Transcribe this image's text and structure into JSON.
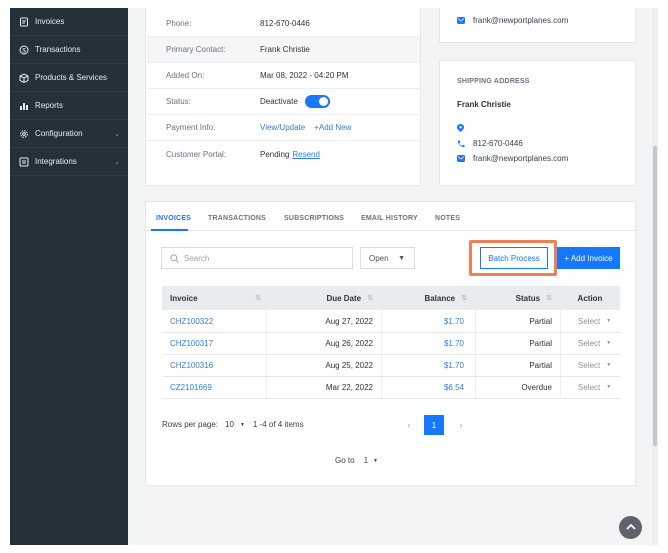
{
  "sidebar": {
    "items": [
      {
        "label": "Invoices",
        "icon": "invoice-icon",
        "chevron": false
      },
      {
        "label": "Transactions",
        "icon": "dollar-circle-icon",
        "chevron": false
      },
      {
        "label": "Products & Services",
        "icon": "box-icon",
        "chevron": false
      },
      {
        "label": "Reports",
        "icon": "bar-chart-icon",
        "chevron": false
      },
      {
        "label": "Configuration",
        "icon": "gear-icon",
        "chevron": true
      },
      {
        "label": "Integrations",
        "icon": "integrations-icon",
        "chevron": true
      }
    ]
  },
  "details": {
    "phone": {
      "label": "Phone:",
      "value": "812-670-0446"
    },
    "primary_contact": {
      "label": "Primary Contact:",
      "value": "Frank Christie"
    },
    "added_on": {
      "label": "Added On:",
      "value": "Mar 08, 2022 - 04:20 PM"
    },
    "status": {
      "label": "Status:",
      "value": "Deactivate",
      "toggle_on": true
    },
    "payment_info": {
      "label": "Payment Info:",
      "link1": "View/Update",
      "link2": "+Add New"
    },
    "customer_portal": {
      "label": "Customer Portal:",
      "value": "Pending",
      "link": "Resend"
    }
  },
  "top_contact": {
    "email": "frank@newportplanes.com"
  },
  "shipping": {
    "title": "SHIPPING ADDRESS",
    "name": "Frank Christie",
    "phone": "812-670-0446",
    "email": "frank@newportplanes.com"
  },
  "tabs": [
    "INVOICES",
    "TRANSACTIONS",
    "SUBSCRIPTIONS",
    "EMAIL HISTORY",
    "NOTES"
  ],
  "toolbar": {
    "search_placeholder": "Search",
    "filter_value": "Open",
    "batch_label": "Batch Process",
    "add_label": "+ Add Invoice"
  },
  "table": {
    "headers": {
      "invoice": "Invoice",
      "due": "Due Date",
      "balance": "Balance",
      "status": "Status",
      "action": "Action"
    },
    "rows": [
      {
        "invoice": "CHZ100322",
        "due": "Aug 27, 2022",
        "balance": "$1.70",
        "status": "Partial",
        "action": "Select"
      },
      {
        "invoice": "CHZ100317",
        "due": "Aug 26, 2022",
        "balance": "$1.70",
        "status": "Partial",
        "action": "Select"
      },
      {
        "invoice": "CHZ100316",
        "due": "Aug 25, 2022",
        "balance": "$1.70",
        "status": "Partial",
        "action": "Select"
      },
      {
        "invoice": "CZ2101669",
        "due": "Mar 22, 2022",
        "balance": "$6.54",
        "status": "Overdue",
        "action": "Select"
      }
    ]
  },
  "pagination": {
    "rows_label": "Rows per page:",
    "rows_value": "10",
    "range": "1 -4 of 4  items",
    "current_page": "1",
    "goto_label": "Go to",
    "goto_value": "1"
  },
  "colors": {
    "accent": "#1677ff",
    "sidebar": "#253139",
    "highlight": "#f07f55"
  }
}
